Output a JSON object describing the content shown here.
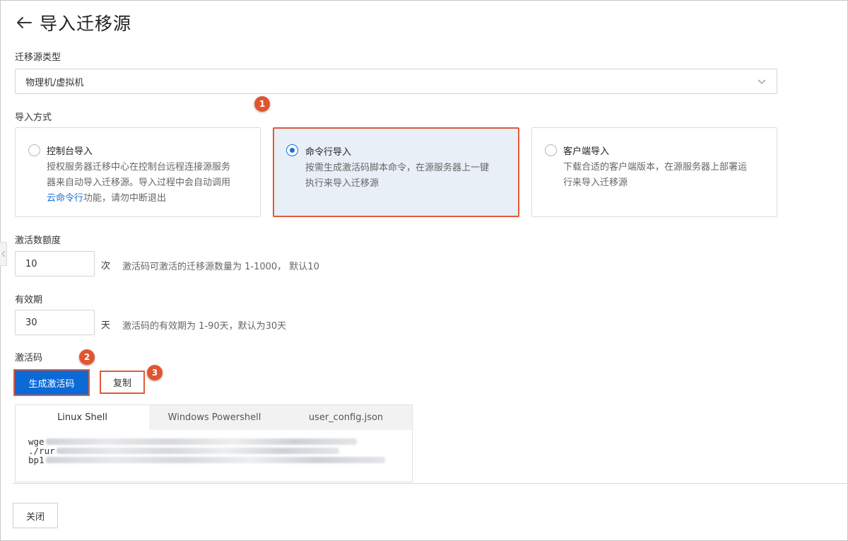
{
  "header": {
    "title": "导入迁移源"
  },
  "source_type": {
    "label": "迁移源类型",
    "selected": "物理机/虚拟机"
  },
  "import_method": {
    "label": "导入方式",
    "options": [
      {
        "title": "控制台导入",
        "desc_line1": "授权服务器迁移中心在控制台远程连接源服务",
        "desc_line2": "器来自动导入迁移源。导入过程中会自动调用",
        "desc_link": "云命令行",
        "desc_line3_rest": "功能，请勿中断退出",
        "selected": false
      },
      {
        "title": "命令行导入",
        "desc_line1": "按需生成激活码脚本命令，在源服务器上一键",
        "desc_line2": "执行来导入迁移源",
        "selected": true
      },
      {
        "title": "客户端导入",
        "desc_line1": "下载合适的客户端版本，在源服务器上部署运",
        "desc_line2": "行来导入迁移源",
        "selected": false
      }
    ]
  },
  "quota": {
    "label": "激活数额度",
    "value": "10",
    "unit": "次",
    "hint": "激活码可激活的迁移源数量为 1-1000， 默认10"
  },
  "validity": {
    "label": "有效期",
    "value": "30",
    "unit": "天",
    "hint": "激活码的有效期为 1-90天，默认为30天"
  },
  "activation": {
    "label": "激活码",
    "generate_label": "生成激活码",
    "copy_label": "复制",
    "tabs": [
      "Linux Shell",
      "Windows Powershell",
      "user_config.json"
    ],
    "active_tab": 0,
    "code_lines": [
      "wge",
      "./rur",
      "bp1"
    ]
  },
  "badges": [
    "1",
    "2",
    "3"
  ],
  "footer": {
    "close_label": "关闭"
  },
  "colors": {
    "primary": "#0b6ad6",
    "highlight": "#e05a38",
    "selected_bg": "#e9eff6",
    "link": "#1a6fd8"
  }
}
